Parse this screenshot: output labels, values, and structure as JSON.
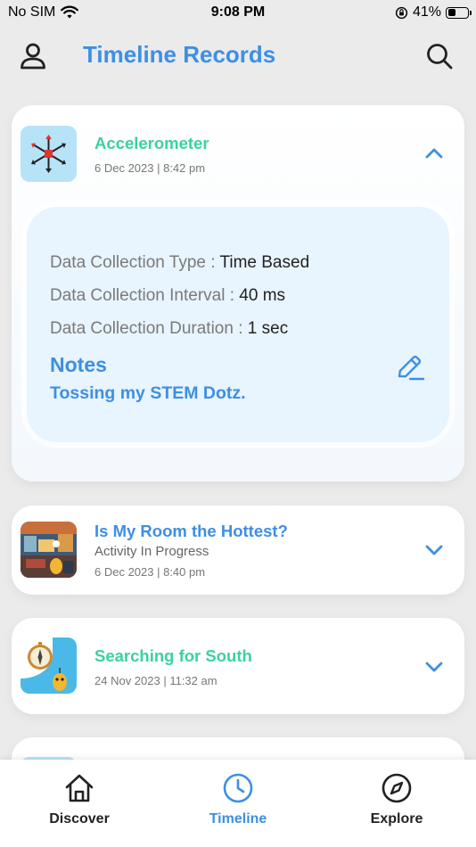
{
  "status_bar": {
    "carrier": "No SIM",
    "time": "9:08 PM",
    "battery_pct": "41%",
    "battery_level": 0.41
  },
  "header": {
    "title": "Timeline Records"
  },
  "records": [
    {
      "title": "Accelerometer",
      "title_color": "#3ad29f",
      "date": "6 Dec 2023 | 8:42 pm",
      "expanded": true,
      "details": [
        {
          "label": "Data Collection Type :",
          "value": "Time Based"
        },
        {
          "label": "Data Collection Interval :",
          "value": "40 ms"
        },
        {
          "label": "Data Collection Duration :",
          "value": "1 sec"
        }
      ],
      "notes_label": "Notes",
      "notes_text": "Tossing my STEM Dotz."
    },
    {
      "title": "Is My Room the Hottest?",
      "title_color": "#3d8fe3",
      "subtitle": "Activity In Progress",
      "date": "6 Dec 2023 | 8:40 pm",
      "expanded": false
    },
    {
      "title": "Searching for South",
      "title_color": "#3ad29f",
      "date": "24 Nov 2023 | 11:32 am",
      "expanded": false
    }
  ],
  "bottom_nav": [
    {
      "label": "Discover",
      "icon": "home-icon",
      "active": false
    },
    {
      "label": "Timeline",
      "icon": "clock-icon",
      "active": true
    },
    {
      "label": "Explore",
      "icon": "compass-icon",
      "active": false
    }
  ],
  "colors": {
    "accent_blue": "#3d8fe3",
    "accent_green": "#3ad29f",
    "detail_bg": "#e8f4fe"
  }
}
